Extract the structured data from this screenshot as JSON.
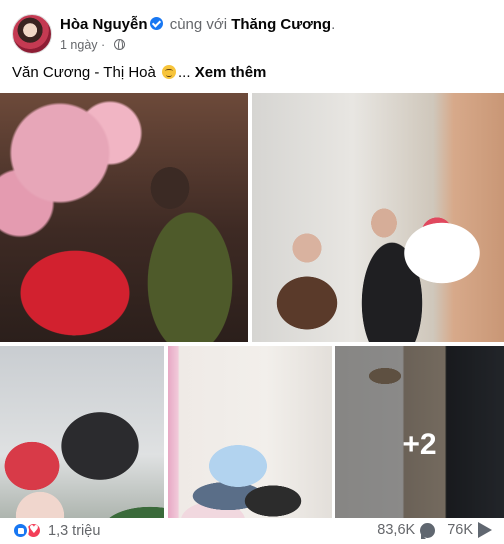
{
  "header": {
    "author": "Hòa Nguyễn",
    "with_text": "cùng với",
    "tagged": "Thăng Cương",
    "period": ".",
    "time": "1 ngày",
    "dot": "·"
  },
  "post": {
    "text": "Văn Cương - Thị Hoà",
    "ellipsis": "...",
    "see_more": "Xem thêm"
  },
  "photos": {
    "more_count": "+2"
  },
  "stats": {
    "reaction_count": "1,3 triệu",
    "comment_count": "83,6K",
    "share_count": "76K"
  },
  "colors": {
    "accent": "#1877f2",
    "love": "#f33e58",
    "muted_text": "#65676b"
  }
}
